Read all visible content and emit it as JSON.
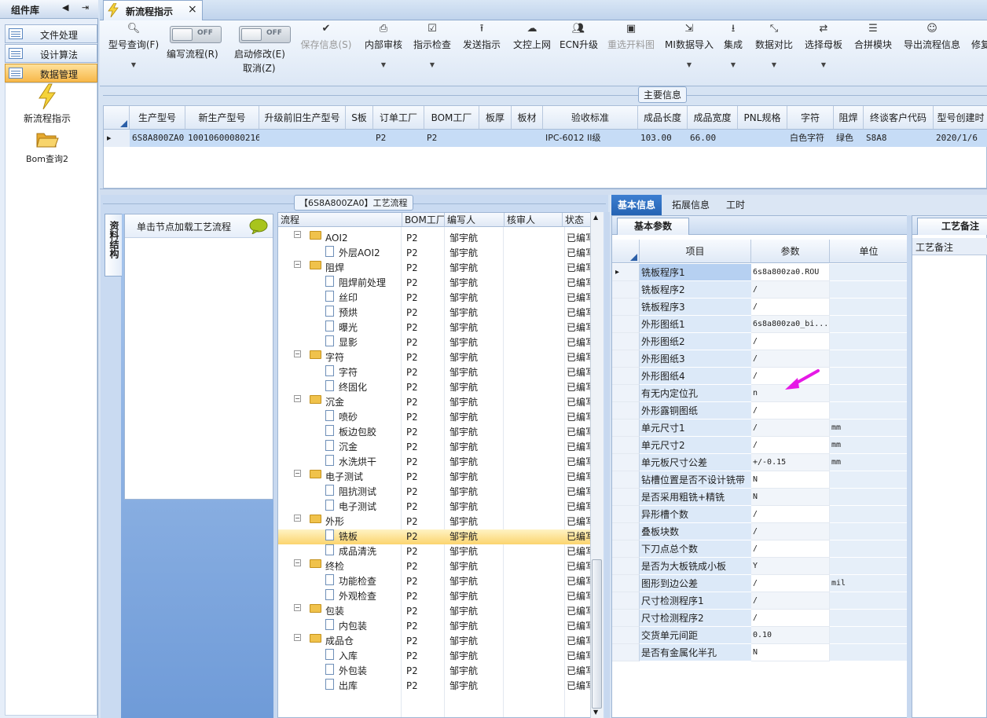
{
  "left_panel": {
    "title": "组件库",
    "categories": [
      "文件处理",
      "设计算法",
      "数据管理"
    ],
    "items": [
      "新流程指示",
      "Bom查询2"
    ]
  },
  "tabs": [
    {
      "label": "新流程指示",
      "close": "×"
    }
  ],
  "toolbar": {
    "buttons": [
      {
        "label": "型号查询(F)",
        "icon": "search-icon"
      },
      {
        "label": "保存信息(S)",
        "icon": "check-icon",
        "disabled": true
      },
      {
        "label": "内部审核",
        "icon": "printer-icon"
      },
      {
        "label": "指示检查",
        "icon": "checkbox-icon"
      },
      {
        "label": "发送指示",
        "icon": "upload-icon"
      },
      {
        "label": "文控上网",
        "icon": "cloud-upload-icon"
      },
      {
        "label": "ECN升级",
        "icon": "user-group-icon"
      },
      {
        "label": "重选开料图",
        "icon": "image-icon",
        "disabled": true
      },
      {
        "label": "MI数据导入",
        "icon": "import-icon"
      },
      {
        "label": "集成",
        "icon": "download-icon"
      },
      {
        "label": "数据对比",
        "icon": "compress-icon"
      },
      {
        "label": "选择母板",
        "icon": "shuffle-icon"
      },
      {
        "label": "合拼模块",
        "icon": "list-icon"
      },
      {
        "label": "导出流程信息",
        "icon": "smile-icon"
      },
      {
        "label": "修复",
        "icon": ""
      }
    ],
    "toggle_write": {
      "label": "编写流程(R)",
      "state": "OFF"
    },
    "toggle_modify": {
      "label": "启动修改(E)",
      "sub": "取消(Z)",
      "state": "OFF"
    }
  },
  "main_info": {
    "section_title": "主要信息",
    "headers": [
      "生产型号",
      "新生产型号",
      "升级前旧生产型号",
      "S板",
      "订单工厂",
      "BOM工厂",
      "板厚",
      "板材",
      "验收标准",
      "成品长度",
      "成品宽度",
      "PNL规格",
      "字符",
      "阻焊",
      "终谈客户代码",
      "型号创建时"
    ],
    "row": [
      "6S8A800ZA0",
      "10010600080216",
      "",
      "",
      "P2",
      "P2",
      "",
      "",
      "IPC-6012 II级",
      "103.00",
      "66.00",
      "",
      "白色字符",
      "绿色",
      "S8A8",
      "2020/1/6"
    ]
  },
  "flow": {
    "section_title": "【6S8A800ZA0】工艺流程",
    "side_tab": "资料结构",
    "node_hint": "单击节点加载工艺流程",
    "headers": [
      "流程",
      "BOM工厂",
      "编写人",
      "核审人",
      "状态"
    ],
    "rows": [
      {
        "name": "AOI2",
        "level": 0,
        "bom": "P2",
        "writer": "邹宇航",
        "status": "已编写"
      },
      {
        "name": "外层AOI2",
        "level": 1,
        "bom": "P2",
        "writer": "邹宇航",
        "status": "已编写"
      },
      {
        "name": "阻焊",
        "level": 0,
        "bom": "P2",
        "writer": "邹宇航",
        "status": "已编写"
      },
      {
        "name": "阻焊前处理",
        "level": 1,
        "bom": "P2",
        "writer": "邹宇航",
        "status": "已编写"
      },
      {
        "name": "丝印",
        "level": 1,
        "bom": "P2",
        "writer": "邹宇航",
        "status": "已编写"
      },
      {
        "name": "预烘",
        "level": 1,
        "bom": "P2",
        "writer": "邹宇航",
        "status": "已编写"
      },
      {
        "name": "曝光",
        "level": 1,
        "bom": "P2",
        "writer": "邹宇航",
        "status": "已编写"
      },
      {
        "name": "显影",
        "level": 1,
        "bom": "P2",
        "writer": "邹宇航",
        "status": "已编写"
      },
      {
        "name": "字符",
        "level": 0,
        "bom": "P2",
        "writer": "邹宇航",
        "status": "已编写"
      },
      {
        "name": "字符",
        "level": 1,
        "bom": "P2",
        "writer": "邹宇航",
        "status": "已编写"
      },
      {
        "name": "终固化",
        "level": 1,
        "bom": "P2",
        "writer": "邹宇航",
        "status": "已编写"
      },
      {
        "name": "沉金",
        "level": 0,
        "bom": "P2",
        "writer": "邹宇航",
        "status": "已编写"
      },
      {
        "name": "喷砂",
        "level": 1,
        "bom": "P2",
        "writer": "邹宇航",
        "status": "已编写"
      },
      {
        "name": "板边包胶",
        "level": 1,
        "bom": "P2",
        "writer": "邹宇航",
        "status": "已编写"
      },
      {
        "name": "沉金",
        "level": 1,
        "bom": "P2",
        "writer": "邹宇航",
        "status": "已编写"
      },
      {
        "name": "水洗烘干",
        "level": 1,
        "bom": "P2",
        "writer": "邹宇航",
        "status": "已编写"
      },
      {
        "name": "电子测试",
        "level": 0,
        "bom": "P2",
        "writer": "邹宇航",
        "status": "已编写"
      },
      {
        "name": "阻抗测试",
        "level": 1,
        "bom": "P2",
        "writer": "邹宇航",
        "status": "已编写"
      },
      {
        "name": "电子测试",
        "level": 1,
        "bom": "P2",
        "writer": "邹宇航",
        "status": "已编写"
      },
      {
        "name": "外形",
        "level": 0,
        "bom": "P2",
        "writer": "邹宇航",
        "status": "已编写"
      },
      {
        "name": "铣板",
        "level": 1,
        "bom": "P2",
        "writer": "邹宇航",
        "status": "已编写",
        "selected": true
      },
      {
        "name": "成品清洗",
        "level": 1,
        "bom": "P2",
        "writer": "邹宇航",
        "status": "已编写"
      },
      {
        "name": "终检",
        "level": 0,
        "bom": "P2",
        "writer": "邹宇航",
        "status": "已编写"
      },
      {
        "name": "功能检查",
        "level": 1,
        "bom": "P2",
        "writer": "邹宇航",
        "status": "已编写"
      },
      {
        "name": "外观检查",
        "level": 1,
        "bom": "P2",
        "writer": "邹宇航",
        "status": "已编写"
      },
      {
        "name": "包装",
        "level": 0,
        "bom": "P2",
        "writer": "邹宇航",
        "status": "已编写"
      },
      {
        "name": "内包装",
        "level": 1,
        "bom": "P2",
        "writer": "邹宇航",
        "status": "已编写"
      },
      {
        "name": "成品仓",
        "level": 0,
        "bom": "P2",
        "writer": "邹宇航",
        "status": "已编写"
      },
      {
        "name": "入库",
        "level": 1,
        "bom": "P2",
        "writer": "邹宇航",
        "status": "已编写"
      },
      {
        "name": "外包装",
        "level": 1,
        "bom": "P2",
        "writer": "邹宇航",
        "status": "已编写"
      },
      {
        "name": "出库",
        "level": 1,
        "bom": "P2",
        "writer": "邹宇航",
        "status": "已编写"
      }
    ]
  },
  "details": {
    "tabs": [
      "基本信息",
      "拓展信息",
      "工时"
    ],
    "panel_title": "基本参数",
    "headers": [
      "项目",
      "参数",
      "单位"
    ],
    "rows": [
      [
        "铣板程序1",
        "6s8a800za0.ROU",
        ""
      ],
      [
        "铣板程序2",
        "/",
        ""
      ],
      [
        "铣板程序3",
        "/",
        ""
      ],
      [
        "外形图纸1",
        "6s8a800za0_bi...",
        ""
      ],
      [
        "外形图纸2",
        "/",
        ""
      ],
      [
        "外形图纸3",
        "/",
        ""
      ],
      [
        "外形图纸4",
        "/",
        ""
      ],
      [
        "有无内定位孔",
        "n",
        ""
      ],
      [
        "外形露铜图纸",
        "/",
        ""
      ],
      [
        "单元尺寸1",
        "/",
        "mm"
      ],
      [
        "单元尺寸2",
        "/",
        "mm"
      ],
      [
        "单元板尺寸公差",
        "+/-0.15",
        "mm"
      ],
      [
        "钻槽位置是否不设计铣带",
        "N",
        ""
      ],
      [
        "是否采用粗铣+精铣",
        "N",
        ""
      ],
      [
        "异形槽个数",
        "/",
        ""
      ],
      [
        "叠板块数",
        "/",
        ""
      ],
      [
        "下刀点总个数",
        "/",
        ""
      ],
      [
        "是否为大板铣成小板",
        "Y",
        ""
      ],
      [
        "图形到边公差",
        "/",
        "mil"
      ],
      [
        "尺寸检测程序1",
        "/",
        ""
      ],
      [
        "尺寸检测程序2",
        "/",
        ""
      ],
      [
        "交货单元间距",
        "0.10",
        ""
      ],
      [
        "是否有金属化半孔",
        "N",
        ""
      ]
    ]
  },
  "remark": {
    "title": "工艺备注",
    "sub": "工艺备注"
  },
  "colors": {
    "accent": "#2563b3",
    "selection": "#fbd46e",
    "arrow": "#e619e6"
  }
}
